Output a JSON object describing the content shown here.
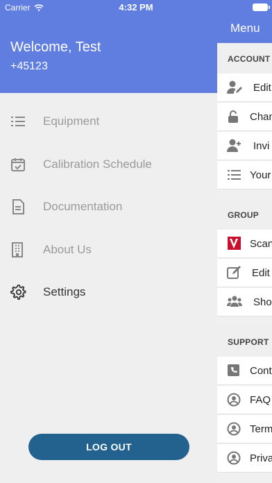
{
  "status_bar": {
    "carrier": "Carrier",
    "time": "4:32 PM"
  },
  "drawer": {
    "welcome": "Welcome, Test",
    "phone": "+45123",
    "items": [
      {
        "label": "Equipment",
        "icon": "list-icon"
      },
      {
        "label": "Calibration Schedule",
        "icon": "calendar-check-icon"
      },
      {
        "label": "Documentation",
        "icon": "document-icon"
      },
      {
        "label": "About Us",
        "icon": "building-icon"
      },
      {
        "label": "Settings",
        "icon": "gear-icon"
      }
    ],
    "logout_label": "LOG OUT"
  },
  "menu_page": {
    "title": "Menu",
    "sections": [
      {
        "heading": "ACCOUNT",
        "rows": [
          {
            "label": "Edit",
            "icon": "user-edit-icon"
          },
          {
            "label": "Chan",
            "icon": "unlock-icon"
          },
          {
            "label": "Invi",
            "icon": "user-plus-icon"
          },
          {
            "label": "Your",
            "icon": "list-icon"
          }
        ]
      },
      {
        "heading": "GROUP",
        "rows": [
          {
            "label": "Scan",
            "icon": "v-logo-icon"
          },
          {
            "label": "Edit",
            "icon": "pencil-square-icon"
          },
          {
            "label": "Sho",
            "icon": "users-icon"
          }
        ]
      },
      {
        "heading": "SUPPORT",
        "rows": [
          {
            "label": "Cont",
            "icon": "phone-icon"
          },
          {
            "label": "FAQ",
            "icon": "user-circle-icon"
          },
          {
            "label": "Term",
            "icon": "user-circle-icon"
          },
          {
            "label": "Priva",
            "icon": "user-circle-icon"
          }
        ]
      }
    ]
  },
  "colors": {
    "header": "#5f7ee0",
    "logout": "#23628f",
    "icon_gray": "#777777",
    "logo_red": "#c8102e"
  }
}
